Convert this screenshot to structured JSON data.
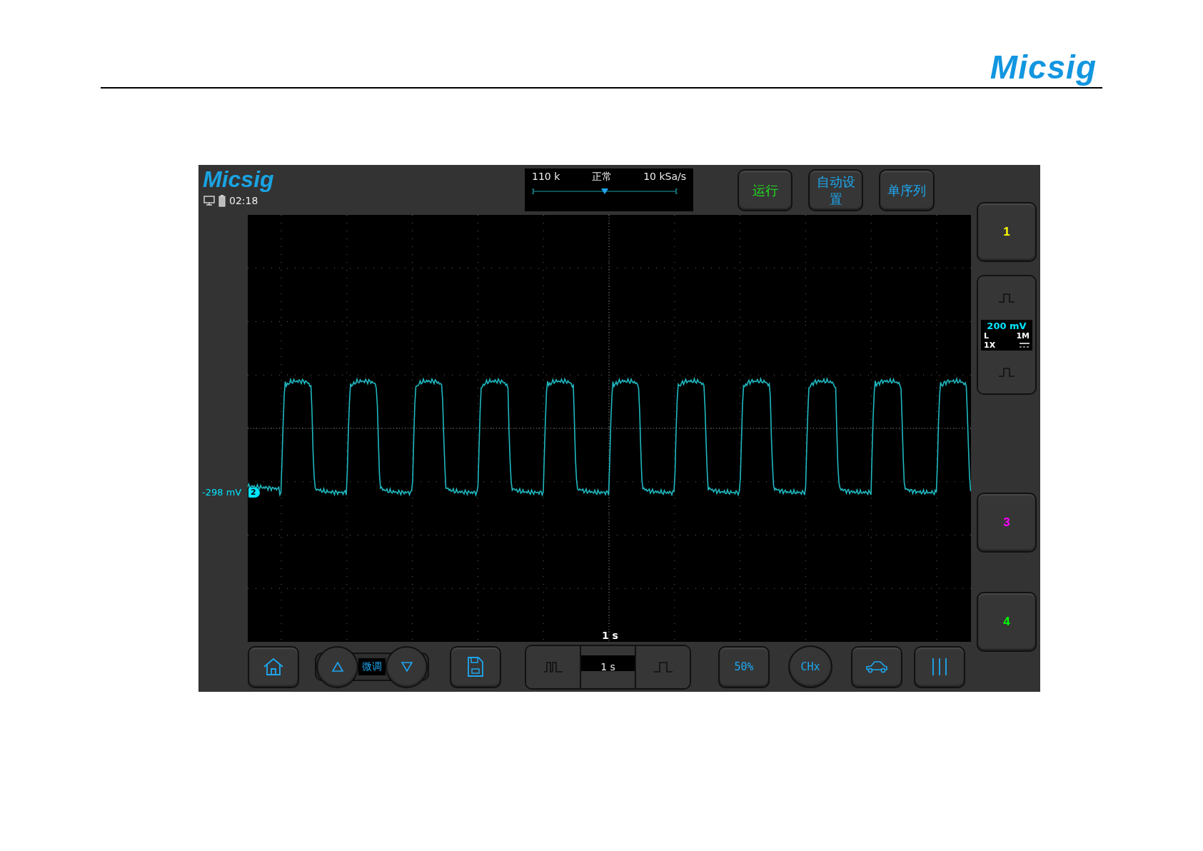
{
  "document": {
    "brand": "Micsig"
  },
  "scope": {
    "brand": "Micsig",
    "time": "02:18",
    "acquisition": {
      "memory": "110 k",
      "mode": "正常",
      "sample_rate": "10 kSa/s",
      "level": 0.5
    },
    "top_buttons": [
      {
        "label": "运行",
        "color": "#22e022"
      },
      {
        "label": "自动设置",
        "color": "#1ea7f0"
      },
      {
        "label": "单序列",
        "color": "#1ea7f0"
      }
    ],
    "channels": [
      {
        "kind": "button",
        "label": "1",
        "color": "#ffff00"
      },
      {
        "kind": "settings",
        "scale": "200 mV",
        "bandwidth": "L",
        "impedance": "1M",
        "probe": "1X"
      },
      {
        "kind": "button",
        "label": "3",
        "color": "#ff00ff"
      },
      {
        "kind": "button",
        "label": "4",
        "color": "#00ff00"
      }
    ],
    "offset_marker": {
      "reading": "-298 mV",
      "channel": "2"
    },
    "plot_timebase": "1 s",
    "toolbar": {
      "fine_label": "微调",
      "timebase": "1 s",
      "trigger_label": "50%",
      "channel_label": "CHx"
    }
  }
}
